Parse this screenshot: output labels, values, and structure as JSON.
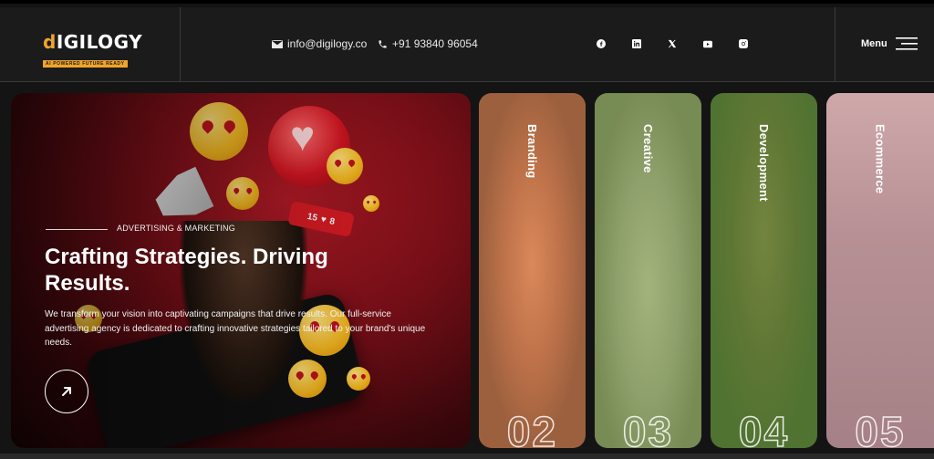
{
  "logo": {
    "word_accent": "d",
    "word_rest": "IGILOGY",
    "tagline": "AI POWERED FUTURE READY"
  },
  "contact": {
    "email": "info@digilogy.co",
    "phone": "+91 93840 96054"
  },
  "socials": [
    "facebook-icon",
    "linkedin-icon",
    "x-icon",
    "youtube-icon",
    "instagram-icon"
  ],
  "menu": {
    "label": "Menu"
  },
  "hero": {
    "kicker": "ADVERTISING & MARKETING",
    "title": "Crafting Strategies. Driving Results.",
    "description": "We transform your vision into captivating campaigns that drive results. Our full-service advertising agency is dedicated to crafting innovative strategies tailored to your brand's unique needs.",
    "like_count": "15",
    "like_count_2": "8"
  },
  "cards": [
    {
      "label": "Branding",
      "number": "02"
    },
    {
      "label": "Creative",
      "number": "03"
    },
    {
      "label": "Development",
      "number": "04"
    },
    {
      "label": "Ecommerce",
      "number": "05"
    }
  ],
  "colors": {
    "accent": "#f0a52a",
    "hero_red": "#b21a26",
    "header_bg": "#1b1b1b"
  }
}
